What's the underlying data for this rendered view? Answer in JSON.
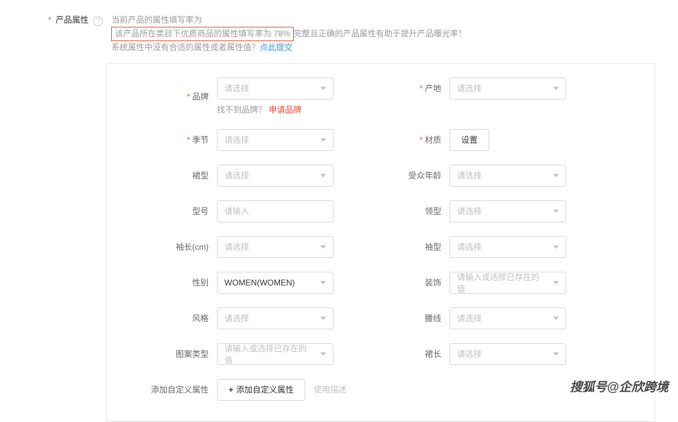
{
  "section": {
    "title": "产品属性",
    "hint1": "当前产品的属性填写率为",
    "hint2_boxed": "该产品所在类目下优质商品的属性填写率为 78%",
    "hint2_rest": "完整且正确的产品属性有助于提升产品曝光率！",
    "hint3_pre": "系统属性中没有合适的属性或者属性值？",
    "hint3_link": "点此提交"
  },
  "fields": {
    "brand": {
      "label": "品牌",
      "placeholder": "请选择",
      "sub_pre": "找不到品牌？",
      "sub_link": "申请品牌"
    },
    "origin": {
      "label": "产地",
      "placeholder": "请选择"
    },
    "season": {
      "label": "季节",
      "placeholder": "请选择"
    },
    "material": {
      "label": "材质",
      "button": "设置"
    },
    "skirt_type": {
      "label": "裙型",
      "placeholder": "请选择"
    },
    "age_group": {
      "label": "受众年龄",
      "placeholder": "请选择"
    },
    "model_no": {
      "label": "型号",
      "placeholder": "请输入"
    },
    "collar": {
      "label": "领型",
      "placeholder": "请选择"
    },
    "sleeve_len": {
      "label": "袖长(cm)",
      "placeholder": "请选择"
    },
    "sleeve_type": {
      "label": "袖型",
      "placeholder": "请选择"
    },
    "gender": {
      "label": "性别",
      "value": "WOMEN(WOMEN)"
    },
    "decoration": {
      "label": "装饰",
      "placeholder": "请输入或选择已存在的值"
    },
    "style": {
      "label": "风格",
      "placeholder": "请选择"
    },
    "waist": {
      "label": "腰线",
      "placeholder": "请选择"
    },
    "pattern": {
      "label": "图案类型",
      "placeholder": "请输入或选择已存在的值"
    },
    "skirt_len": {
      "label": "裙长",
      "placeholder": "请选择"
    },
    "custom": {
      "label": "添加自定义属性",
      "button": "添加自定义属性",
      "desc": "使用描述"
    }
  },
  "watermark": "搜狐号@企欣跨境"
}
